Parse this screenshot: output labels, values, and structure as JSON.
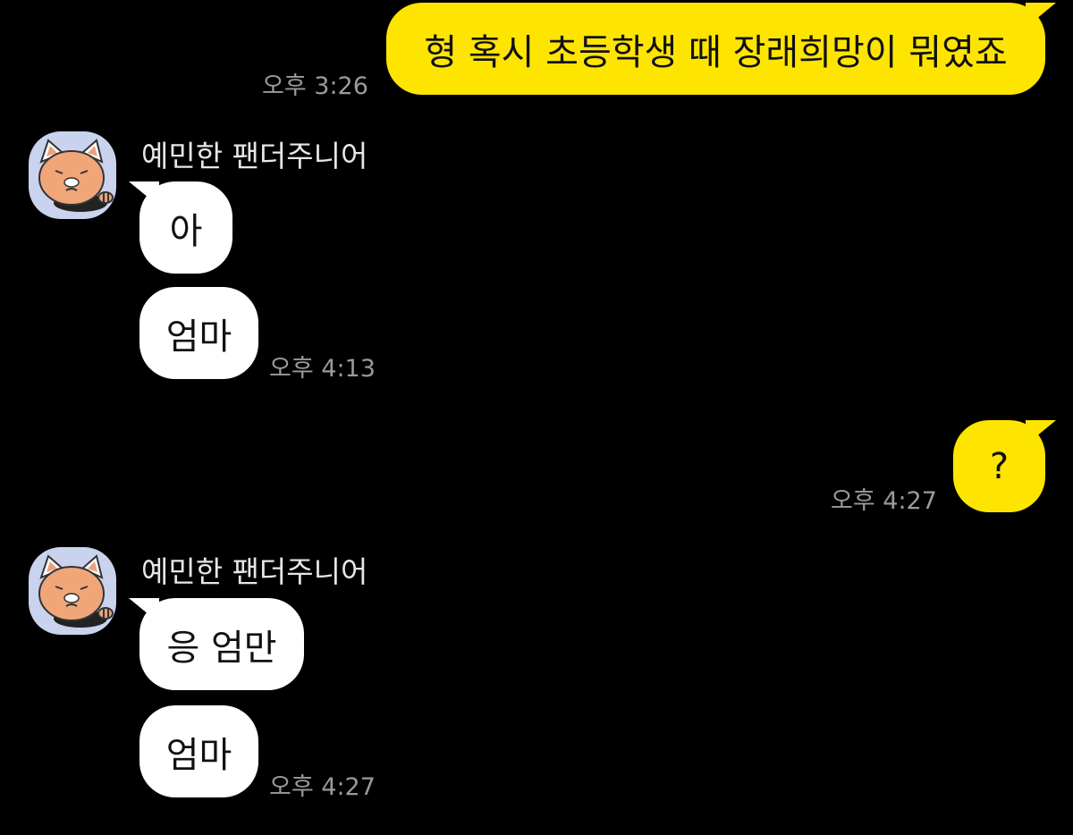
{
  "messages": {
    "m1": {
      "text": "형 혹시 초등학생 때 장래희망이 뭐였죠",
      "time": "오후 3:26"
    },
    "g1": {
      "sender": "예민한 팬더주니어",
      "avatar_icon": "red-panda-avatar-icon",
      "b1": "아",
      "b2": "엄마",
      "time": "오후 4:13"
    },
    "m2": {
      "text": "?",
      "time": "오후 4:27"
    },
    "g2": {
      "sender": "예민한 팬더주니어",
      "avatar_icon": "red-panda-avatar-icon",
      "b1": "응 엄만",
      "b2": "엄마",
      "time": "오후 4:27"
    }
  },
  "colors": {
    "background": "#000000",
    "my_bubble": "#FEE500",
    "their_bubble": "#FFFFFF",
    "timestamp": "#9A9A9A",
    "sender_name": "#E6E6E6",
    "avatar_bg": "#C9D3EE"
  }
}
